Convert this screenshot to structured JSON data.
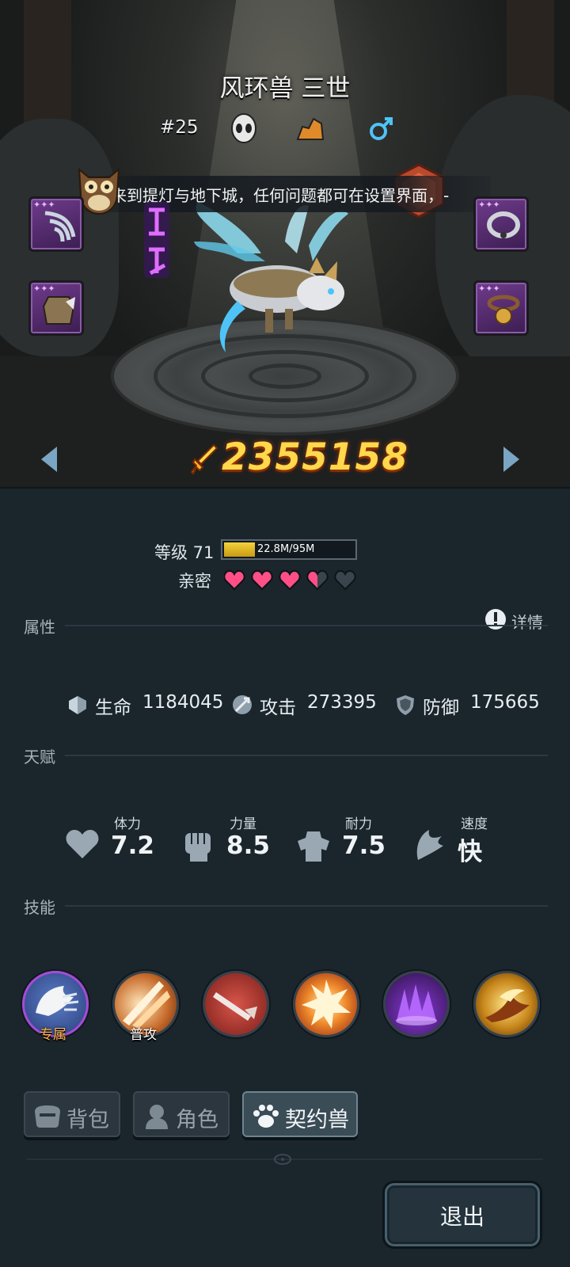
{
  "pet": {
    "name": "风环兽 三世",
    "number": "#25",
    "notice": "来到提灯与地下城，任何问题都可在设置界面，-",
    "combat_power": "2355158"
  },
  "level": {
    "label": "等级 71",
    "xp_text": "22.8M/95M",
    "xp_progress": 0.24
  },
  "intimacy": {
    "label": "亲密",
    "hearts_total": 5,
    "hearts_filled": 3.5
  },
  "detail_label": "详情",
  "sections": {
    "attributes": "属性",
    "talents": "天赋",
    "skills": "技能"
  },
  "attributes": [
    {
      "label": "生命",
      "value": "1184045",
      "icon": "life-icon"
    },
    {
      "label": "攻击",
      "value": "273395",
      "icon": "attack-icon"
    },
    {
      "label": "防御",
      "value": "175665",
      "icon": "defense-icon"
    }
  ],
  "talents": [
    {
      "label": "体力",
      "value": "7.2",
      "icon": "heart-icon"
    },
    {
      "label": "力量",
      "value": "8.5",
      "icon": "fist-icon"
    },
    {
      "label": "耐力",
      "value": "7.5",
      "icon": "armor-icon"
    },
    {
      "label": "速度",
      "value": "快",
      "icon": "wing-icon"
    }
  ],
  "skills": [
    {
      "tag": "专属",
      "icon": "exclusive-skill-icon"
    },
    {
      "tag": "普攻",
      "icon": "basic-attack-icon"
    },
    {
      "tag": "",
      "icon": "sword-skill-icon"
    },
    {
      "tag": "",
      "icon": "burst-skill-icon"
    },
    {
      "tag": "",
      "icon": "shadow-skill-icon"
    },
    {
      "tag": "",
      "icon": "flame-skill-icon"
    }
  ],
  "tabs": [
    {
      "label": "背包",
      "icon": "bag-icon"
    },
    {
      "label": "角色",
      "icon": "character-icon"
    },
    {
      "label": "契约兽",
      "icon": "paw-icon"
    }
  ],
  "exit_label": "退出",
  "colors": {
    "power": "#ffd84c",
    "heart": "#ff4f86",
    "equip_bg": "#6f3c8c",
    "accent_blue": "#4fc3f7"
  }
}
